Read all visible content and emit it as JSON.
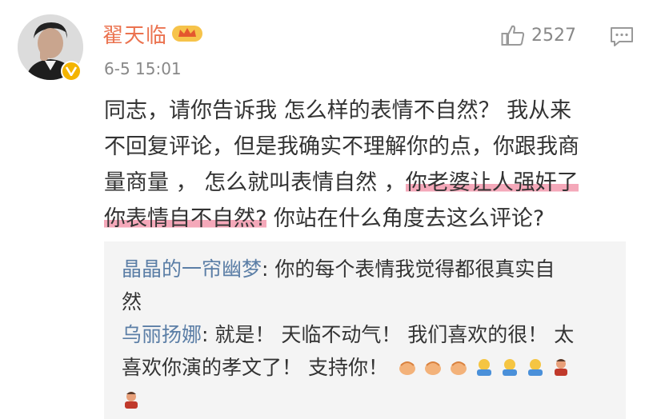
{
  "post": {
    "username": "翟天临",
    "timestamp": "6-5 15:01",
    "like_count": "2527",
    "content_lines": [
      [
        "同志，请你告诉我 怎么样的表情不自然？ 我从来"
      ],
      [
        "不回复评论，但是我确实不理解你的点，你跟我商"
      ],
      [
        "量商量 ， 怎么就叫表情自然 ，",
        "你老婆让人强奸了"
      ],
      [
        "你表情自不自然?",
        " 你站在什么角度去这么评论?"
      ]
    ]
  },
  "replies": [
    {
      "user": "晶晶的一帘幽梦",
      "lines": [
        ": 你的每个表情我觉得都很真实自",
        "然"
      ]
    },
    {
      "user": "乌丽扬娜",
      "lines": [
        ": 就是！ 天临不动气！ 我们喜欢的很！ 太",
        "喜欢你演的孝文了！ 支持你！"
      ]
    }
  ],
  "emojis": [
    "clap-emoji",
    "clap-emoji",
    "clap-emoji",
    "thumbs-emoji",
    "thumbs-emoji",
    "thumbs-emoji",
    "person-emoji",
    "person-emoji"
  ],
  "colors": {
    "username": "#eb7350",
    "reply_user": "#5b7ea6",
    "highlight": "#ec6080",
    "badge": "#f4b400"
  }
}
